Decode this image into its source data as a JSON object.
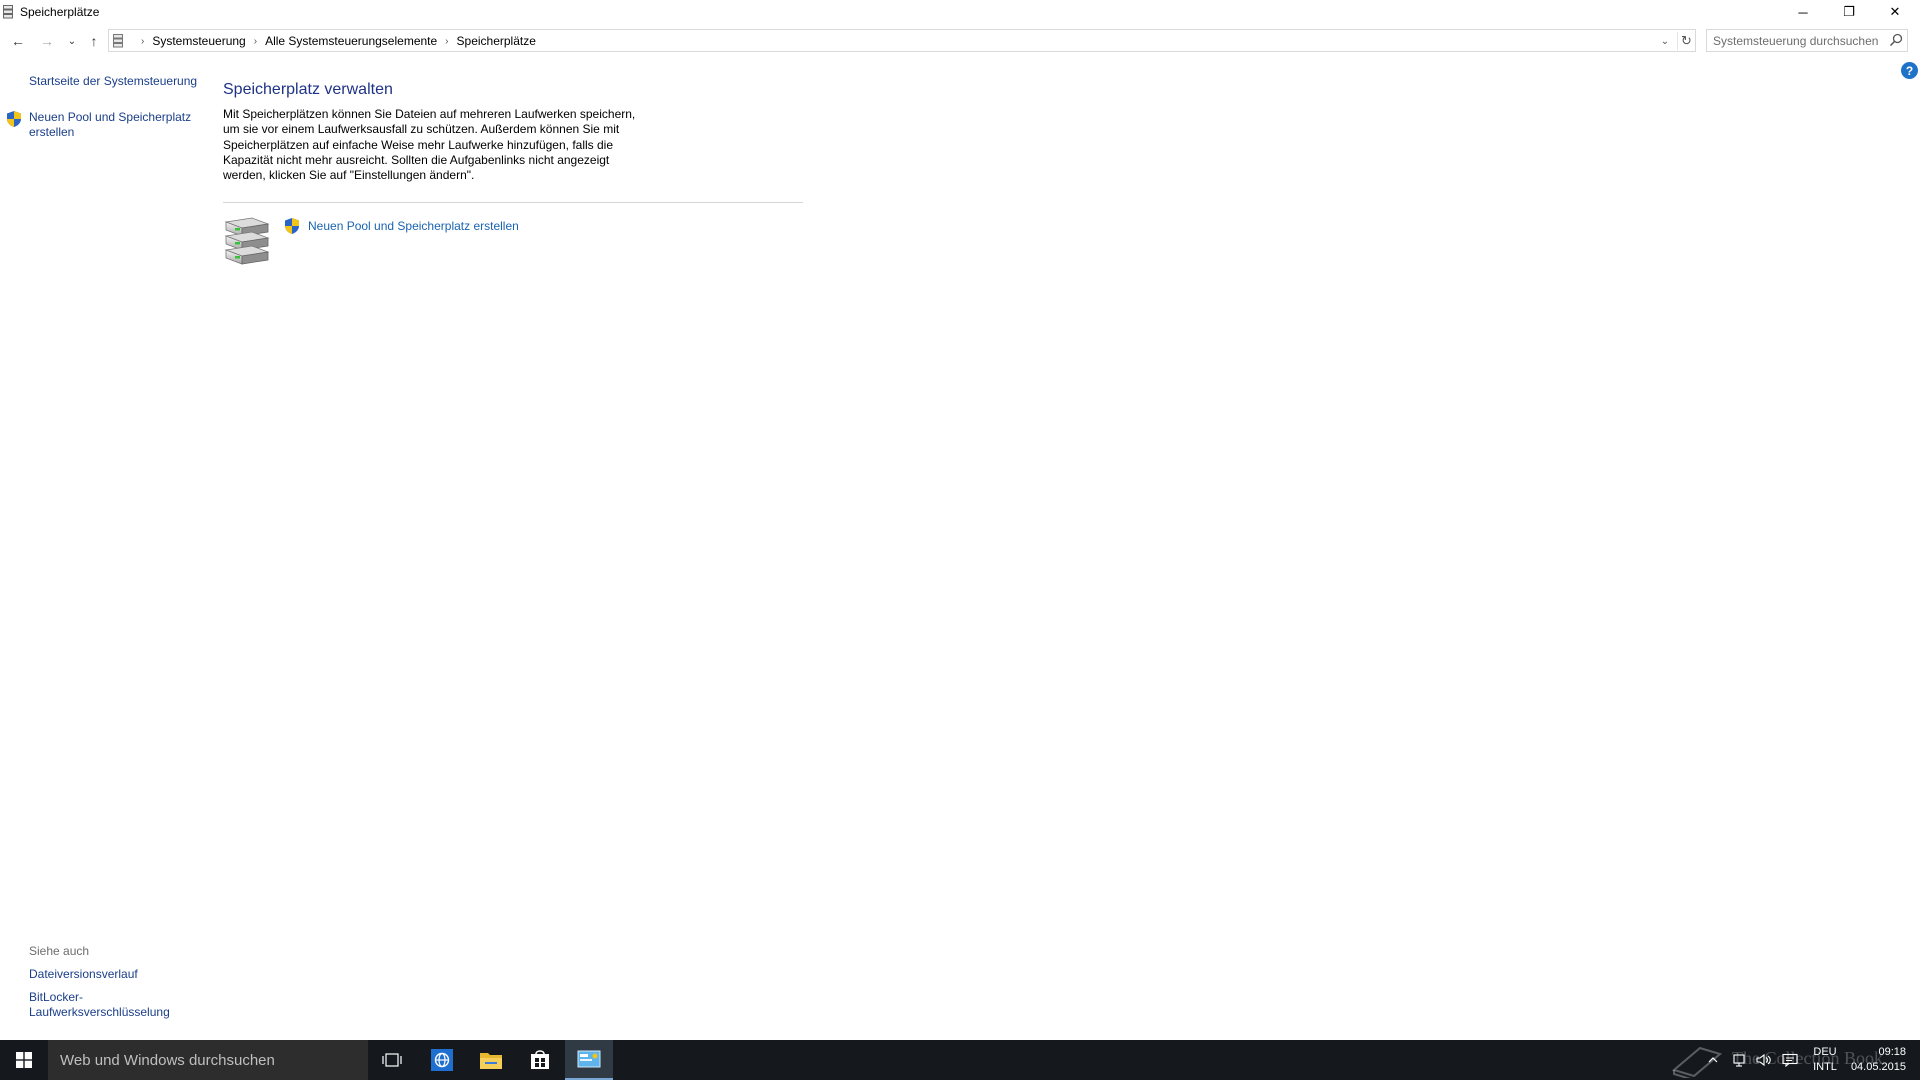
{
  "window": {
    "title": "Speicherplätze",
    "minimize": "─",
    "maximize": "❐",
    "close": "✕"
  },
  "nav": {
    "back": "←",
    "forward": "→",
    "recent": "⌄",
    "up": "↑",
    "breadcrumbs": [
      "Systemsteuerung",
      "Alle Systemsteuerungselemente",
      "Speicherplätze"
    ],
    "breadcrumb_separator": "›",
    "dropdown": "⌄",
    "refresh": "↻",
    "search_placeholder": "Systemsteuerung durchsuchen"
  },
  "help": {
    "label": "?"
  },
  "sidebar": {
    "home_link": "Startseite der Systemsteuerung",
    "create_link": "Neuen Pool und Speicherplatz erstellen",
    "see_also_heading": "Siehe auch",
    "see_also": [
      "Dateiversionsverlauf",
      "BitLocker-Laufwerksverschlüsselung"
    ]
  },
  "main": {
    "title": "Speicherplatz verwalten",
    "description": "Mit Speicherplätzen können Sie Dateien auf mehreren Laufwerken speichern, um sie vor einem Laufwerksausfall zu schützen. Außerdem können Sie mit Speicherplätzen auf einfache Weise mehr Laufwerke hinzufügen, falls die Kapazität nicht mehr ausreicht. Sollten die Aufgabenlinks nicht angezeigt werden, klicken Sie auf \"Einstellungen ändern\".",
    "create_link": "Neuen Pool und Speicherplatz erstellen"
  },
  "taskbar": {
    "search_placeholder": "Web und Windows durchsuchen",
    "watermark": "The Collection Book",
    "language": [
      "DEU",
      "INTL"
    ],
    "time": "09:18",
    "date": "04.05.2015"
  },
  "colors": {
    "link": "#1a3e8a",
    "title": "#1e3287",
    "taskbar": "#15191d"
  }
}
